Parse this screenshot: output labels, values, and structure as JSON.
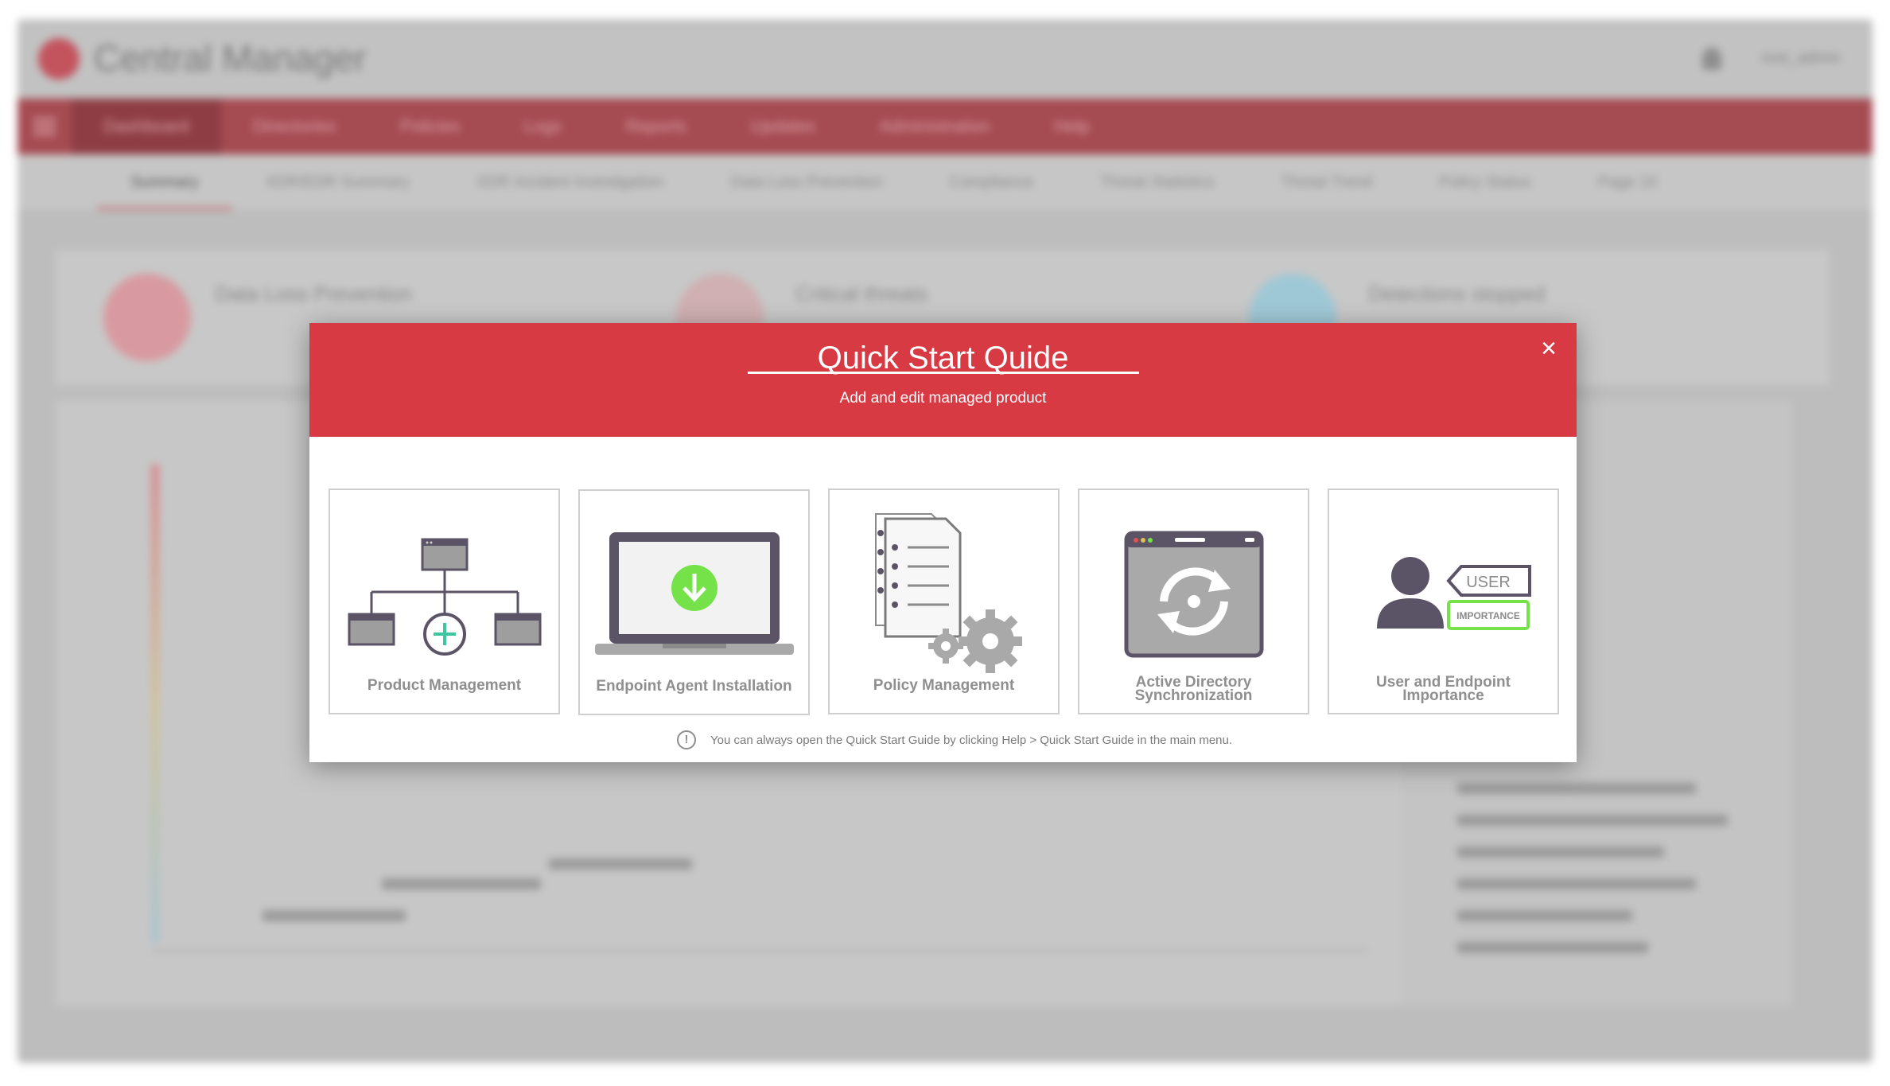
{
  "background_app": {
    "title": "Central Manager",
    "user": "root_admin",
    "nav_items": [
      "Dashboard",
      "Directories",
      "Policies",
      "Logs",
      "Reports",
      "Updates",
      "Administration",
      "Help"
    ],
    "tabs": [
      "Summary",
      "XDR/EDR Summary",
      "XDR Incident Investigation",
      "Data Loss Prevention",
      "Compliance",
      "Threat Statistics",
      "Threat Trend",
      "Policy Status",
      "Page 10"
    ],
    "cards": [
      "Data Loss Prevention",
      "Critical threats",
      "Detections stopped"
    ]
  },
  "modal": {
    "title": "Quick Start Quide",
    "subtitle": "Add and edit managed product",
    "close_symbol": "×",
    "cards": [
      {
        "label": "Product Management",
        "icon": "product-management-icon"
      },
      {
        "label": "Endpoint Agent Installation",
        "icon": "endpoint-agent-installation-icon"
      },
      {
        "label": "Policy Management",
        "icon": "policy-management-icon"
      },
      {
        "label_line1": "Active Directory",
        "label_line2": "Synchronization",
        "icon": "active-directory-sync-icon"
      },
      {
        "label_line1": "User and Endpoint",
        "label_line2": "Importance",
        "icon": "user-endpoint-importance-icon"
      }
    ],
    "icon_text": {
      "user_tag": "USER",
      "importance_tag": "IMPORTANCE"
    },
    "info_icon_symbol": "!",
    "footer_note": "You can always open the Quick Start Guide by clicking Help > Quick Start Guide in the main menu."
  },
  "colors": {
    "header_red": "#d83a44",
    "icon_dark": "#5b5366",
    "icon_gray": "#a9a9a9",
    "accent_green": "#76e24a",
    "teal": "#3ec6a2",
    "label_gray": "#8f8f8f"
  }
}
